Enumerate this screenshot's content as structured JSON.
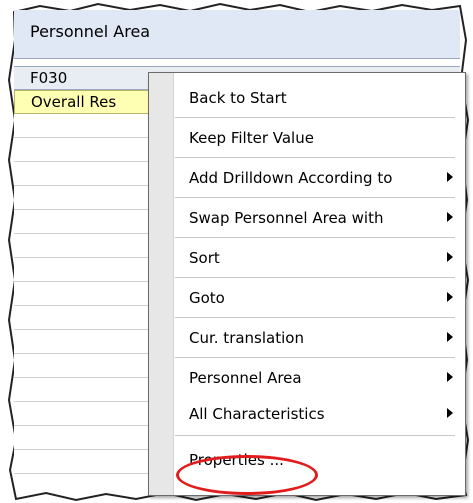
{
  "header": {
    "title": "Personnel Area"
  },
  "rows": {
    "key_value": "F030",
    "overall_label": "Overall Res"
  },
  "context_menu": {
    "items": [
      {
        "label": "Back to Start",
        "submenu": false
      },
      {
        "label": "Keep Filter Value",
        "submenu": false
      },
      {
        "label": "Add Drilldown According to",
        "submenu": true
      },
      {
        "label": "Swap Personnel Area with",
        "submenu": true
      },
      {
        "label": "Sort",
        "submenu": true
      },
      {
        "label": "Goto",
        "submenu": true
      },
      {
        "label": "Cur. translation",
        "submenu": true
      },
      {
        "label": "Personnel Area",
        "submenu": true
      },
      {
        "label": "All Characteristics",
        "submenu": true
      },
      {
        "label": "Properties ...",
        "submenu": false
      }
    ]
  },
  "colors": {
    "header_bg": "#dfe8f4",
    "overall_bg": "#ffffb3",
    "highlight_ring": "#e01c1c"
  },
  "icons": {
    "submenu": "triangle-right-icon"
  }
}
